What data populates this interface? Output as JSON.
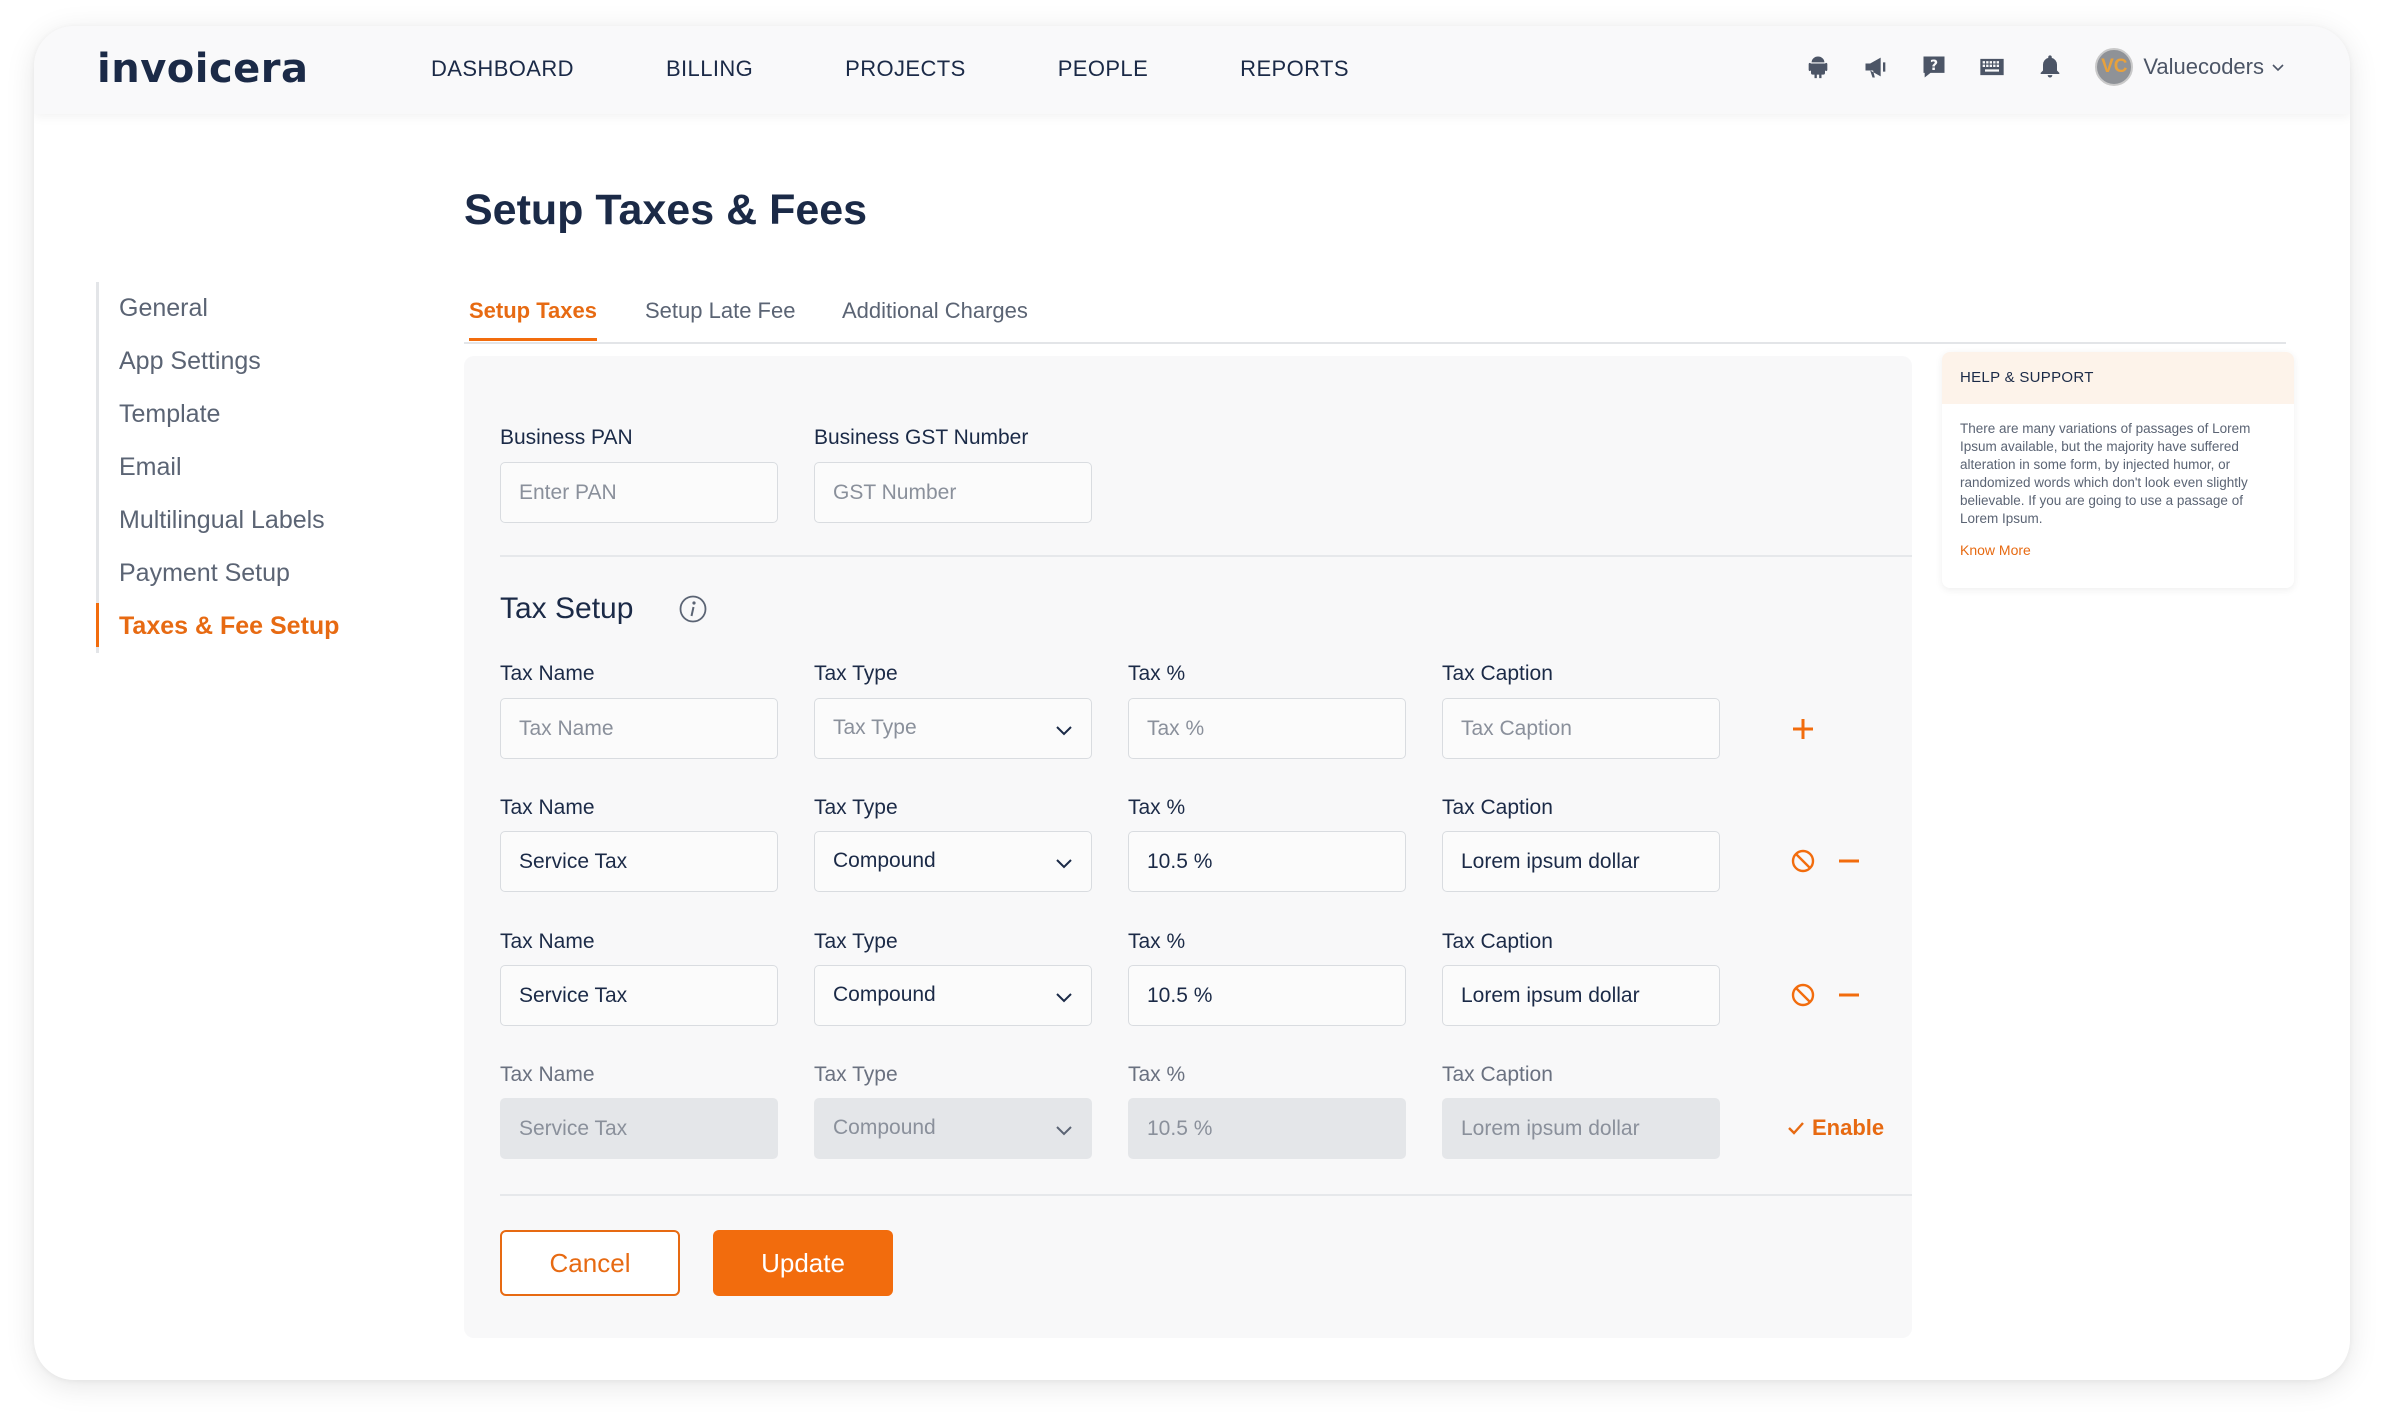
{
  "brand": {
    "logo_text": "invoicera",
    "accent": "#f26c0d"
  },
  "nav": {
    "items": [
      "DASHBOARD",
      "BILLING",
      "PROJECTS",
      "PEOPLE",
      "REPORTS"
    ]
  },
  "header": {
    "icons": [
      "android-icon",
      "megaphone-icon",
      "help-chat-icon",
      "keyboard-icon",
      "bell-icon"
    ],
    "avatar_initials": "VC",
    "user_name": "Valuecoders"
  },
  "sidebar": {
    "items": [
      "General",
      "App Settings",
      "Template",
      "Email",
      "Multilingual Labels",
      "Payment Setup",
      "Taxes & Fee Setup"
    ],
    "active": "Taxes & Fee Setup"
  },
  "page": {
    "title": "Setup Taxes & Fees"
  },
  "tabs": {
    "items": [
      "Setup Taxes",
      "Setup Late Fee",
      "Additional Charges"
    ],
    "active": "Setup Taxes"
  },
  "business": {
    "pan_label": "Business PAN",
    "pan_placeholder": "Enter PAN",
    "gst_label": "Business GST Number",
    "gst_placeholder": "GST Number"
  },
  "tax_setup": {
    "title": "Tax Setup",
    "labels": {
      "name": "Tax Name",
      "type": "Tax Type",
      "percent": "Tax %",
      "caption": "Tax Caption"
    },
    "placeholders": {
      "name": "Tax Name",
      "type": "Tax Type",
      "percent": "Tax %",
      "caption": "Tax Caption"
    },
    "rows": [
      {
        "name": "Service Tax",
        "type": "Compound",
        "percent": "10.5 %",
        "caption": "Lorem ipsum dollar"
      },
      {
        "name": "Service Tax",
        "type": "Compound",
        "percent": "10.5 %",
        "caption": "Lorem ipsum dollar"
      }
    ],
    "disabled_row": {
      "name": "Service Tax",
      "type": "Compound",
      "percent": "10.5 %",
      "caption": "Lorem ipsum dollar"
    },
    "enable_label": "Enable"
  },
  "buttons": {
    "cancel": "Cancel",
    "update": "Update"
  },
  "help": {
    "title": "HELP & SUPPORT",
    "body": "There are many variations of passages of Lorem Ipsum available, but the majority have suffered alteration in some form, by injected humor, or randomized words which don't look even slightly believable. If you are going to use a passage of Lorem Ipsum.",
    "link": "Know More"
  }
}
